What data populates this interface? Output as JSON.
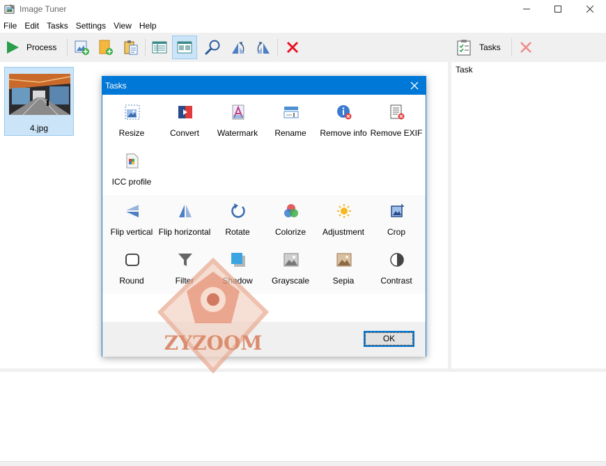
{
  "window": {
    "title": "Image Tuner",
    "icons": {
      "app": "app-icon",
      "minimize": "minimize-icon",
      "maximize": "maximize-icon",
      "close": "close-icon"
    }
  },
  "menu": [
    "File",
    "Edit",
    "Tasks",
    "Settings",
    "View",
    "Help"
  ],
  "toolbar": {
    "process_label": "Process",
    "tasks_label": "Tasks"
  },
  "file_list": {
    "items": [
      {
        "name": "4.jpg"
      }
    ]
  },
  "task_panel": {
    "header": "Task"
  },
  "dialog": {
    "title": "Tasks",
    "ok_label": "OK",
    "tasks": [
      {
        "label": "Resize",
        "icon": "resize-icon"
      },
      {
        "label": "Convert",
        "icon": "convert-icon"
      },
      {
        "label": "Watermark",
        "icon": "watermark-icon"
      },
      {
        "label": "Rename",
        "icon": "rename-icon"
      },
      {
        "label": "Remove info",
        "icon": "remove-info-icon"
      },
      {
        "label": "Remove EXIF",
        "icon": "remove-exif-icon"
      },
      {
        "label": "ICC profile",
        "icon": "icc-profile-icon"
      },
      {
        "label": "Flip vertical",
        "icon": "flip-vertical-icon"
      },
      {
        "label": "Flip horizontal",
        "icon": "flip-horizontal-icon"
      },
      {
        "label": "Rotate",
        "icon": "rotate-icon"
      },
      {
        "label": "Colorize",
        "icon": "colorize-icon"
      },
      {
        "label": "Adjustment",
        "icon": "adjustment-icon"
      },
      {
        "label": "Crop",
        "icon": "crop-icon"
      },
      {
        "label": "Round",
        "icon": "round-icon"
      },
      {
        "label": "Filter",
        "icon": "filter-icon"
      },
      {
        "label": "Shadow",
        "icon": "shadow-icon"
      },
      {
        "label": "Grayscale",
        "icon": "grayscale-icon"
      },
      {
        "label": "Sepia",
        "icon": "sepia-icon"
      },
      {
        "label": "Contrast",
        "icon": "contrast-icon"
      }
    ]
  },
  "watermark": {
    "text": "ZYZOOM"
  },
  "colors": {
    "accent": "#0078d7",
    "toolbar_bg": "#f0f0f0",
    "selection": "#cce4f7",
    "delete_red": "#e81123"
  }
}
